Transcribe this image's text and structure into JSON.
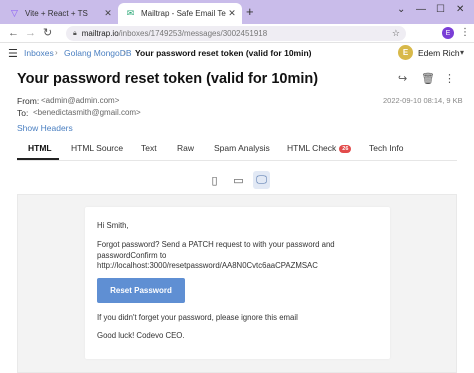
{
  "browser": {
    "tabs": [
      {
        "title": "Vite + React + TS",
        "favicon": "V"
      },
      {
        "title": "Mailtrap - Safe Email Testing",
        "favicon": "✉"
      }
    ],
    "url_host": "mailtrap.io",
    "url_path": "/inboxes/1749253/messages/3002451918",
    "profile_initial": "E"
  },
  "header": {
    "breadcrumb": [
      "Inboxes",
      "Golang MongoDB",
      "Your password reset token (valid for 10min)"
    ],
    "user_initial": "E",
    "user_name": "Edem Rich"
  },
  "message": {
    "subject": "Your password reset token (valid for 10min)",
    "from_label": "From:",
    "from": "<admin@admin.com>",
    "to_label": "To:",
    "to": "<benedictasmith@gmail.com>",
    "date_size": "2022-09-10 08:14, 9 KB",
    "show_headers": "Show Headers"
  },
  "tabs": {
    "items": [
      "HTML",
      "HTML Source",
      "Text",
      "Raw",
      "Spam Analysis",
      "HTML Check",
      "Tech Info"
    ],
    "active": "HTML",
    "html_check_badge": "26"
  },
  "email": {
    "greeting": "Hi Smith,",
    "line1": "Forgot password? Send a PATCH request to with your password and",
    "line2": "passwordConfirm to",
    "line3": "http://localhost:3000/resetpassword/AA8N0Cvtc6aaCPAZMSAC",
    "button": "Reset Password",
    "ignore": "If you didn't forget your password, please ignore this email",
    "signoff": "Good luck! Codevo CEO."
  },
  "colors": {
    "accent": "#4a7fc1",
    "button": "#5f8fd3",
    "badge": "#e24b4b",
    "tabstrip": "#c9bcea"
  }
}
